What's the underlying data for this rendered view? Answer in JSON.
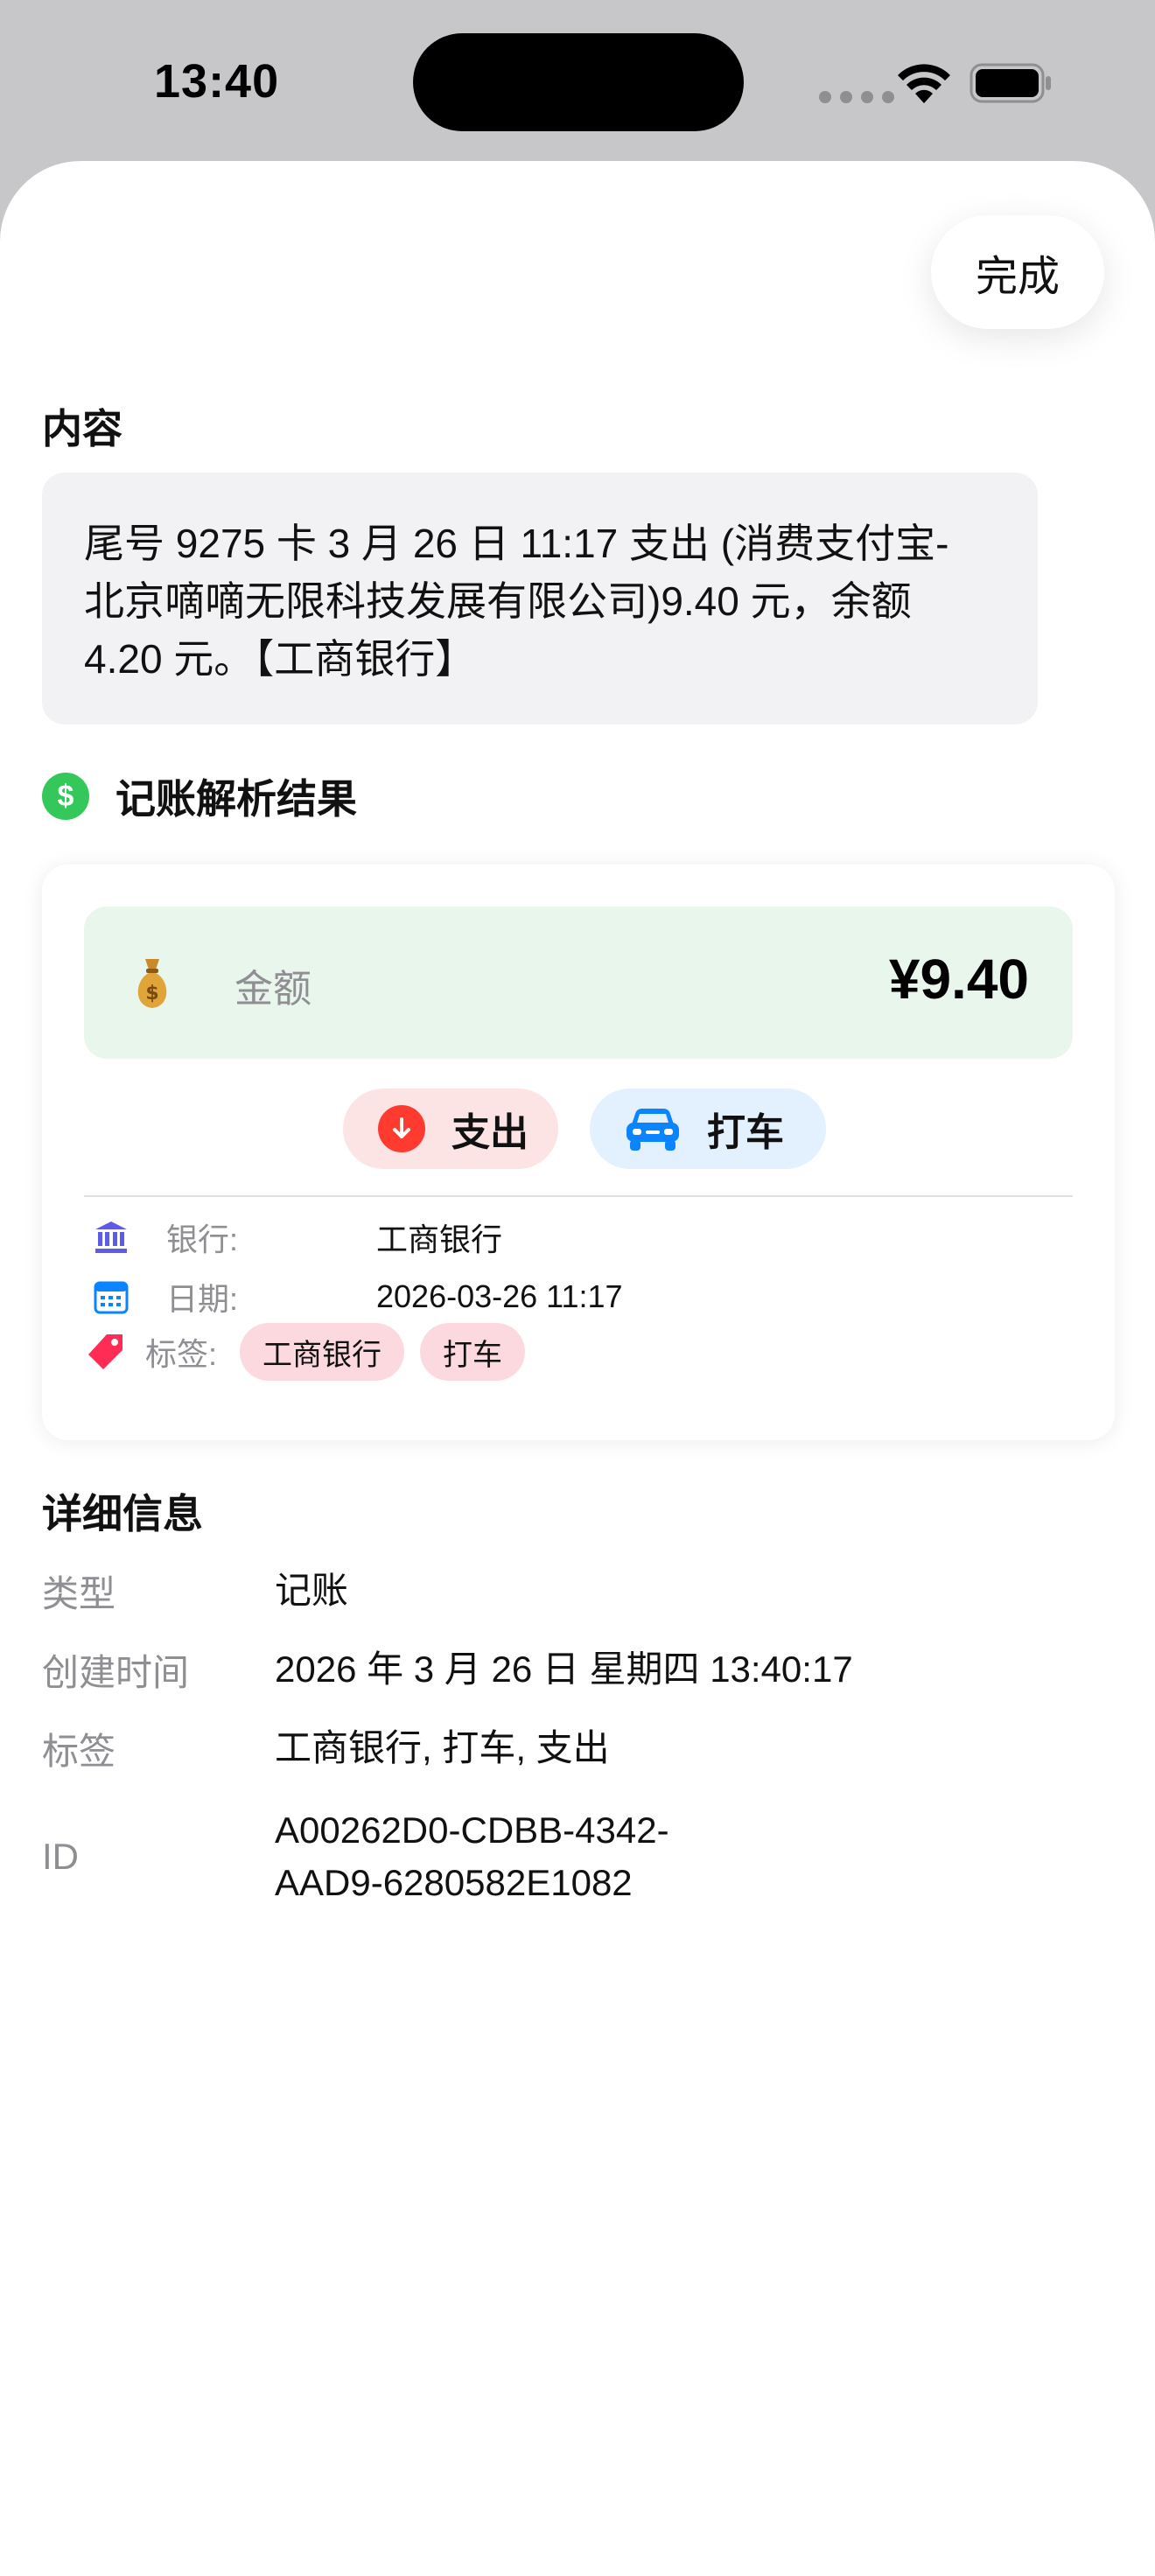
{
  "status_bar": {
    "time": "13:40"
  },
  "sheet": {
    "done_label": "完成"
  },
  "content_section": {
    "heading": "内容",
    "lines": [
      "尾号 9275 卡 3 月 26 日 11:17 支出 (消费支付宝-",
      "北京嘀嘀无限科技发展有限公司)9.40 元，余额",
      "4.20 元。【工商银行】"
    ]
  },
  "parse_result": {
    "title": "记账解析结果",
    "title_icon": "dollar-circle-icon",
    "amount": {
      "label": "金额",
      "value": "¥9.40",
      "icon": "moneybag-icon"
    },
    "type_pill": {
      "label": "支出",
      "icon": "arrow-down-circle-icon",
      "color": "#ff3b30"
    },
    "category_pill": {
      "label": "打车",
      "icon": "car-icon",
      "color": "#0a84ff"
    },
    "bank": {
      "label": "银行:",
      "value": "工商银行",
      "icon": "bank-icon"
    },
    "date": {
      "label": "日期:",
      "value": "2026-03-26 11:17",
      "icon": "calendar-icon"
    },
    "tags": {
      "label": "标签:",
      "icon": "tag-icon",
      "items": [
        "工商银行",
        "打车"
      ]
    }
  },
  "details": {
    "heading": "详细信息",
    "rows": [
      {
        "label": "类型",
        "value": "记账"
      },
      {
        "label": "创建时间",
        "value": "2026 年 3 月 26 日 星期四 13:40:17"
      },
      {
        "label": "标签",
        "value": "工商银行, 打车, 支出"
      },
      {
        "label": "ID",
        "value_lines": [
          "A00262D0-CDBB-4342-",
          "AAD9-6280582E1082"
        ]
      }
    ]
  },
  "colors": {
    "accent_green": "#34c759",
    "expense_red": "#ff3b30",
    "amount_bg": "#e9f6ec",
    "tag_chip_bg": "#fcd9de"
  }
}
